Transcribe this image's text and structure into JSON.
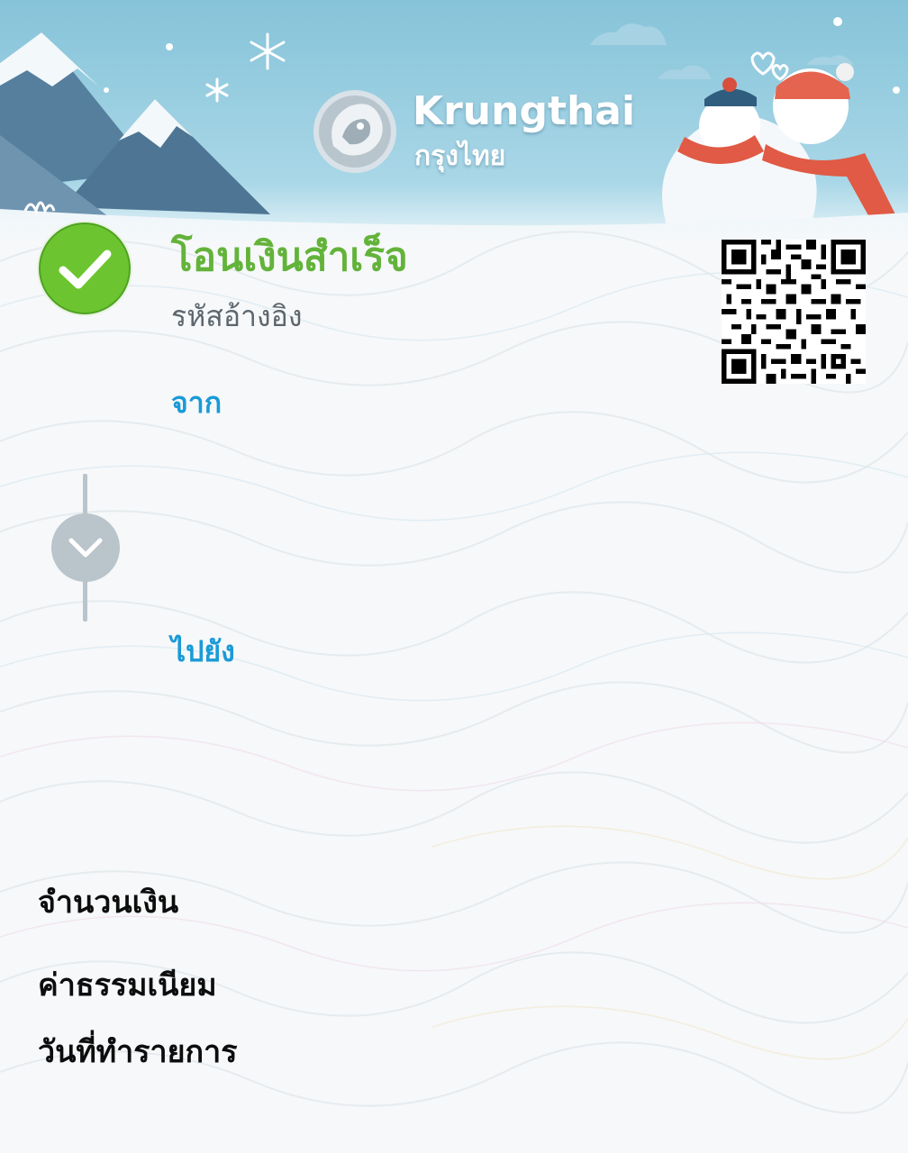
{
  "header": {
    "brand_name": "Krungthai",
    "brand_name_th": "กรุงไทย"
  },
  "icons": {
    "status": "check-circle-icon",
    "qr": "qr-code-icon",
    "connector": "chevron-down-icon",
    "emblem": "bank-emblem-logo"
  },
  "status": {
    "title": "โอนเงินสำเร็จ",
    "reference_label": "รหัสอ้างอิง"
  },
  "transfer": {
    "from_label": "จาก",
    "to_label": "ไปยัง"
  },
  "summary": {
    "amount_label": "จำนวนเงิน",
    "fee_label": "ค่าธรรมเนียม",
    "date_label": "วันที่ทำรายการ"
  },
  "colors": {
    "success_green": "#63b33a",
    "link_blue": "#1a9ad6",
    "sky_blue": "#8cc6de",
    "connector_gray": "#b9c4cb"
  }
}
